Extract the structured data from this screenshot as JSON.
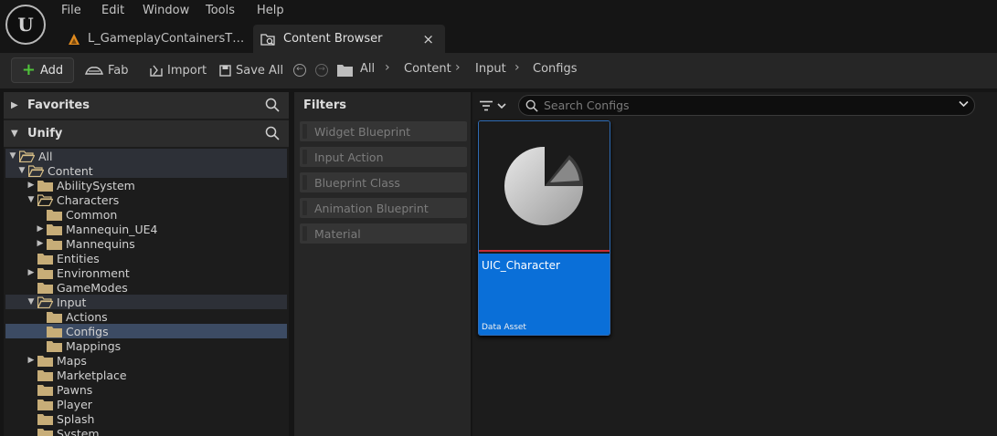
{
  "menu": [
    "File",
    "Edit",
    "Window",
    "Tools",
    "Help"
  ],
  "tabs": {
    "level": "L_GameplayContainersT…",
    "content_browser": "Content Browser",
    "close_glyph": "×"
  },
  "toolbar": {
    "add": "Add",
    "fab": "Fab",
    "import": "Import",
    "save_all": "Save All"
  },
  "breadcrumb": [
    "All",
    "Content",
    "Input",
    "Configs"
  ],
  "left_panel": {
    "favorites": "Favorites",
    "project": "Unify"
  },
  "tree": [
    {
      "label": "All",
      "depth": 0,
      "state": "open",
      "hl": true
    },
    {
      "label": "Content",
      "depth": 1,
      "state": "open",
      "hl": true
    },
    {
      "label": "AbilitySystem",
      "depth": 2,
      "state": "closed"
    },
    {
      "label": "Characters",
      "depth": 2,
      "state": "open"
    },
    {
      "label": "Common",
      "depth": 3,
      "state": "none"
    },
    {
      "label": "Mannequin_UE4",
      "depth": 3,
      "state": "closed"
    },
    {
      "label": "Mannequins",
      "depth": 3,
      "state": "closed"
    },
    {
      "label": "Entities",
      "depth": 2,
      "state": "none"
    },
    {
      "label": "Environment",
      "depth": 2,
      "state": "closed"
    },
    {
      "label": "GameModes",
      "depth": 2,
      "state": "none"
    },
    {
      "label": "Input",
      "depth": 2,
      "state": "open",
      "hl": true
    },
    {
      "label": "Actions",
      "depth": 3,
      "state": "none"
    },
    {
      "label": "Configs",
      "depth": 3,
      "state": "none",
      "sel": true
    },
    {
      "label": "Mappings",
      "depth": 3,
      "state": "none"
    },
    {
      "label": "Maps",
      "depth": 2,
      "state": "closed"
    },
    {
      "label": "Marketplace",
      "depth": 2,
      "state": "none"
    },
    {
      "label": "Pawns",
      "depth": 2,
      "state": "none"
    },
    {
      "label": "Player",
      "depth": 2,
      "state": "none"
    },
    {
      "label": "Splash",
      "depth": 2,
      "state": "none"
    },
    {
      "label": "System",
      "depth": 2,
      "state": "none"
    }
  ],
  "filters": {
    "title": "Filters",
    "items": [
      "Widget Blueprint",
      "Input Action",
      "Blueprint Class",
      "Animation Blueprint",
      "Material"
    ]
  },
  "search": {
    "placeholder": "Search Configs",
    "value": ""
  },
  "asset": {
    "name": "UIC_Character",
    "type": "Data Asset"
  },
  "colors": {
    "accent": "#0a6fd8",
    "selected_row": "#3c4b63",
    "add_icon": "#4fc23a",
    "asset_border": "#c52b36"
  }
}
